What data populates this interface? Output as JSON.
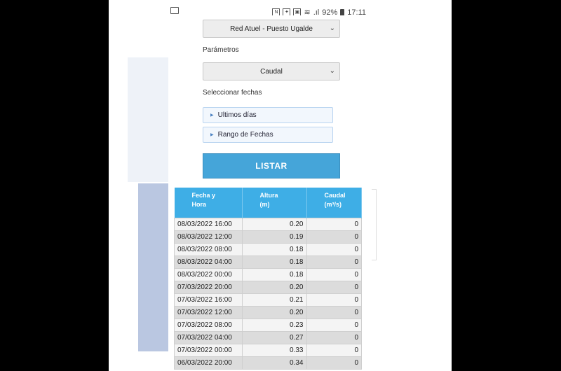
{
  "status_bar": {
    "icons": [
      "screen-icon",
      "nfc-icon",
      "settings-icon",
      "media-icon",
      "wifi-icon",
      "signal-icon",
      "battery-icon"
    ],
    "battery": "92%",
    "time": "17:11"
  },
  "form": {
    "station_select": "Red Atuel - Puesto Ugalde",
    "parametros_label": "Parámetros",
    "parametros_select": "Caudal",
    "fechas_label": "Seleccionar fechas",
    "accordion_1": "Ultimos días",
    "accordion_2": "Rango de Fechas",
    "listar_button": "LISTAR"
  },
  "table": {
    "headers": [
      {
        "line1": "Fecha y",
        "line2": "Hora"
      },
      {
        "line1": "Altura",
        "line2": "(m)"
      },
      {
        "line1": "Caudal",
        "line2": "(m³/s)"
      }
    ],
    "rows": [
      {
        "fecha": "08/03/2022 16:00",
        "altura": "0.20",
        "caudal": "0"
      },
      {
        "fecha": "08/03/2022 12:00",
        "altura": "0.19",
        "caudal": "0"
      },
      {
        "fecha": "08/03/2022 08:00",
        "altura": "0.18",
        "caudal": "0"
      },
      {
        "fecha": "08/03/2022 04:00",
        "altura": "0.18",
        "caudal": "0"
      },
      {
        "fecha": "08/03/2022 00:00",
        "altura": "0.18",
        "caudal": "0"
      },
      {
        "fecha": "07/03/2022 20:00",
        "altura": "0.20",
        "caudal": "0"
      },
      {
        "fecha": "07/03/2022 16:00",
        "altura": "0.21",
        "caudal": "0"
      },
      {
        "fecha": "07/03/2022 12:00",
        "altura": "0.20",
        "caudal": "0"
      },
      {
        "fecha": "07/03/2022 08:00",
        "altura": "0.23",
        "caudal": "0"
      },
      {
        "fecha": "07/03/2022 04:00",
        "altura": "0.27",
        "caudal": "0"
      },
      {
        "fecha": "07/03/2022 00:00",
        "altura": "0.33",
        "caudal": "0"
      },
      {
        "fecha": "06/03/2022 20:00",
        "altura": "0.34",
        "caudal": "0"
      }
    ]
  }
}
